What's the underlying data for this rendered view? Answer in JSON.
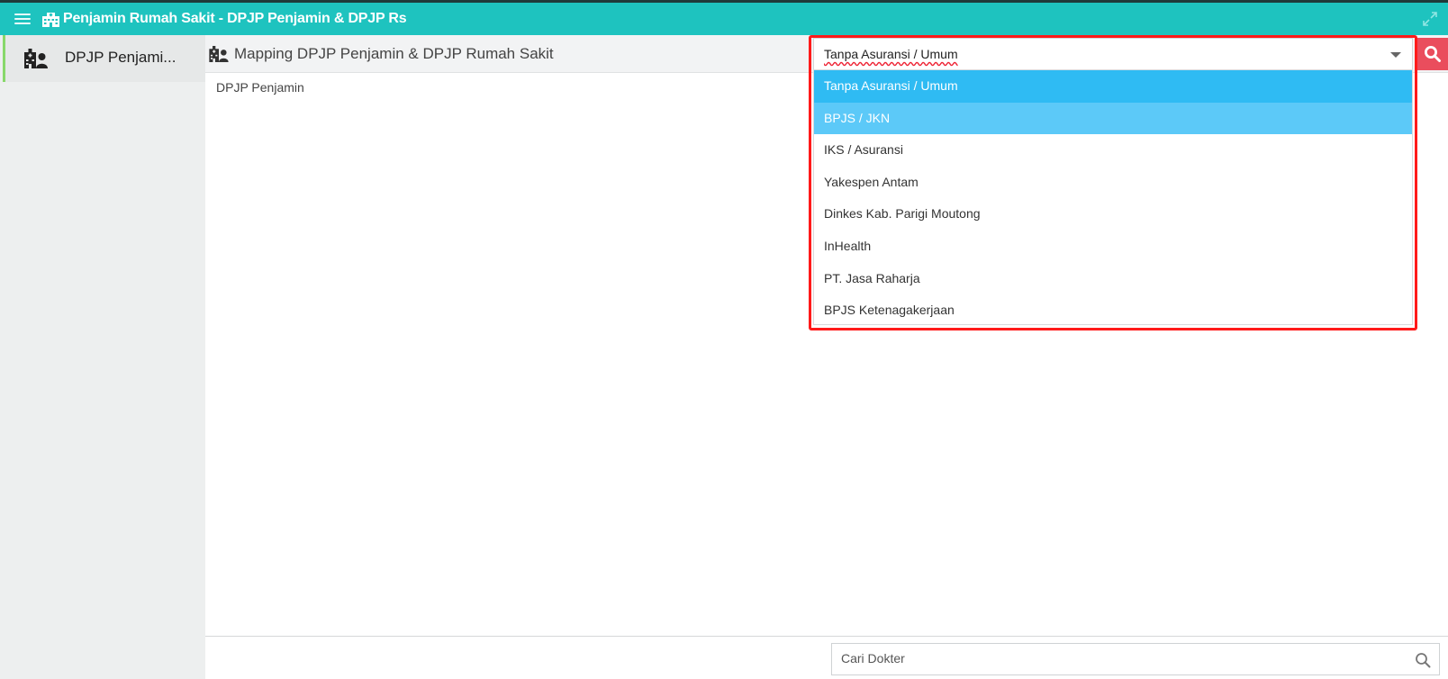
{
  "window": {
    "title": "Penjamin Rumah Sakit - DPJP Penjamin & DPJP Rs",
    "title_icon": "hospital-icon"
  },
  "sidebar": {
    "items": [
      {
        "label": "DPJP Penjami...",
        "icon": "hospital-user-icon",
        "active": true
      }
    ]
  },
  "main": {
    "header_title": "Mapping DPJP Penjamin & DPJP Rumah Sakit",
    "sub_label": "DPJP Penjamin"
  },
  "penjamin_select": {
    "value": "Tanpa Asuransi / Umum",
    "options": [
      "Tanpa Asuransi / Umum",
      "BPJS / JKN",
      "IKS / Asuransi",
      "Yakespen Antam",
      "Dinkes Kab. Parigi Moutong",
      "InHealth",
      "PT. Jasa Raharja",
      "BPJS Ketenagakerjaan"
    ],
    "selected_index": 0,
    "hover_index": 1
  },
  "search": {
    "placeholder": "Cari Dokter"
  },
  "colors": {
    "titlebar": "#1ec3bf",
    "option_selected": "#2fbbf3",
    "option_hover": "#5cc9f8",
    "search_button": "#ea4d5d",
    "highlight_border": "#ff1a1a",
    "active_indicator": "#87d86a"
  }
}
